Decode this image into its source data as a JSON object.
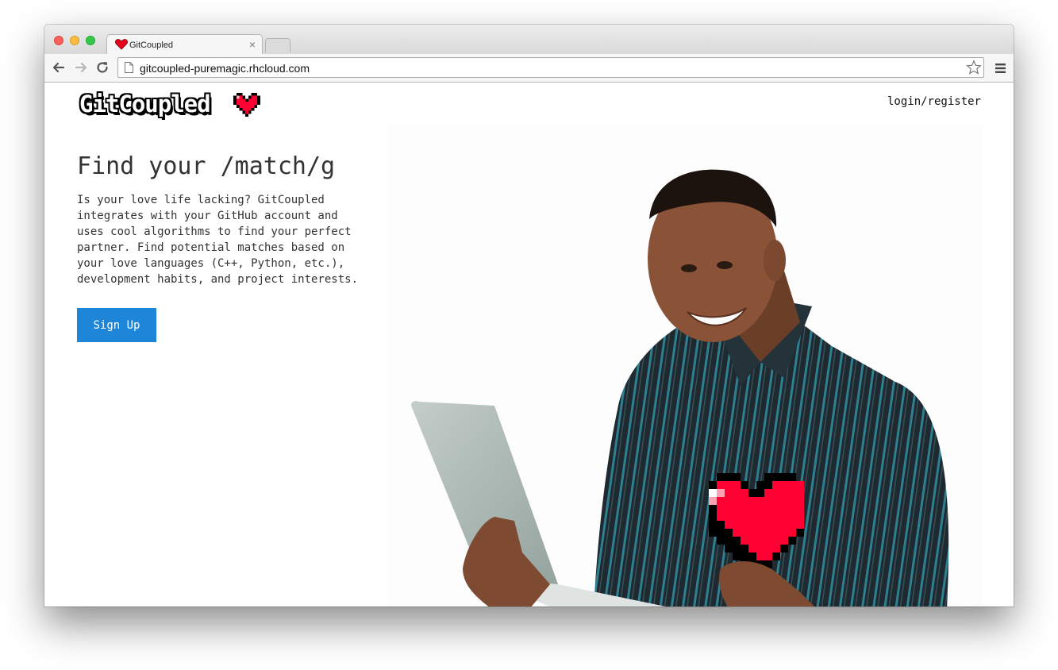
{
  "browser": {
    "tab_title": "GitCoupled",
    "tab_close": "×",
    "url": "gitcoupled-puremagic.rhcloud.com",
    "icons": [
      "back-icon",
      "forward-icon",
      "reload-icon",
      "page-icon",
      "star-icon",
      "menu-icon",
      "heart-favicon"
    ]
  },
  "site": {
    "logo_text": "GitCoupled",
    "nav_login": "login/register",
    "hero_title": "Find your /match/g",
    "hero_text": "Is your love life lacking? GitCoupled integrates with your GitHub account and uses cool algorithms to find your perfect partner. Find potential matches based on your love languages (C++, Python, etc.), development habits, and project interests.",
    "signup_label": "Sign Up"
  },
  "colors": {
    "accent": "#1e86d9",
    "heart": "#ff0033",
    "text": "#333333"
  }
}
